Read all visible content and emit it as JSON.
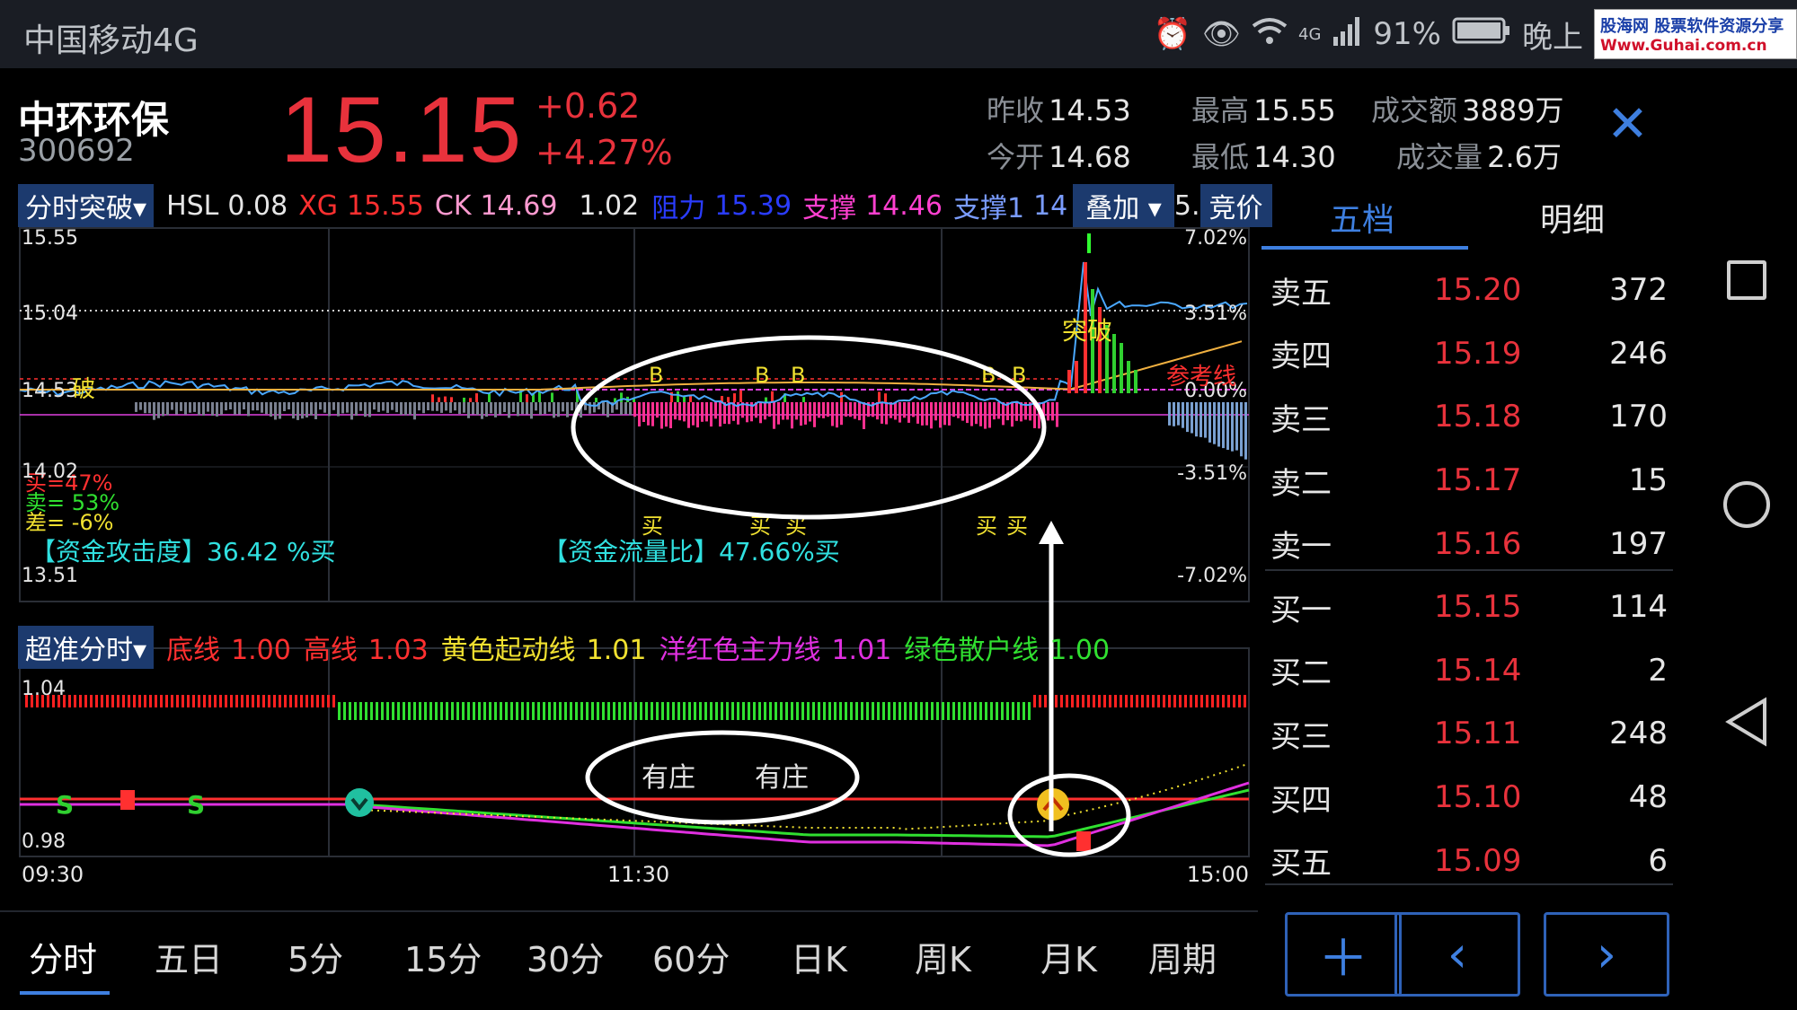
{
  "status_bar": {
    "carrier": "中国移动4G",
    "network": "4G",
    "battery": "91%",
    "time_text": "晚上",
    "watermark_line1": "股海网 股票软件资源分享",
    "watermark_line2": "Www.Guhai.com.cn"
  },
  "stock": {
    "name": "中环环保",
    "code": "300692",
    "price": "15.15",
    "change": "+0.62",
    "change_pct": "+4.27%",
    "quote": {
      "prev_close_label": "昨收",
      "prev_close": "14.53",
      "open_label": "今开",
      "open": "14.68",
      "high_label": "最高",
      "high": "15.55",
      "low_label": "最低",
      "low": "14.30",
      "amount_label": "成交额",
      "amount": "3889万",
      "volume_label": "成交量",
      "volume": "2.6万"
    }
  },
  "indicator_bar": {
    "dropdown": "分时突破",
    "hsl_label": "HSL",
    "hsl": "0.08",
    "xg_label": "XG",
    "xg": "15.55",
    "ck_label": "CK",
    "ck": "14.69",
    "v1": "1.02",
    "zuli_label": "阻力",
    "zuli": "15.39",
    "zhicheng_label": "支撑",
    "zhicheng": "14.46",
    "zhicheng1_label": "支撑1",
    "zhicheng1": "14",
    "overlay": "叠加",
    "trail": "5.",
    "jingjia": "竞价"
  },
  "top_chart": {
    "y_labels_left": [
      "15.55",
      "15.04",
      "14.53",
      "14.02",
      "13.51"
    ],
    "y_labels_right": [
      "7.02%",
      "3.51%",
      "0.00%",
      "-3.51%",
      "-7.02%"
    ],
    "breakout_text": "突破",
    "left_break_text": "破",
    "reference_line_text": "参考线",
    "b_marks": [
      "B",
      "B",
      "B",
      "B",
      "B"
    ],
    "sell_marks": [
      "买",
      "买",
      "买",
      "买",
      "买"
    ],
    "buy_ratio": "买=47%",
    "sell_ratio": "卖= 53%",
    "diff_ratio": "差= -6%",
    "attack": "【资金攻击度】36.42 %买",
    "flow": "【资金流量比】47.66%买"
  },
  "bottom_chart": {
    "dropdown": "超准分时",
    "legend": [
      {
        "label": "底线",
        "value": "1.00",
        "color": "#ff3030"
      },
      {
        "label": "高线",
        "value": "1.03",
        "color": "#ff3030"
      },
      {
        "label": "黄色起动线",
        "value": "1.01",
        "color": "#f0e030"
      },
      {
        "label": "洋红色主力线",
        "value": "1.01",
        "color": "#e030e0"
      },
      {
        "label": "绿色散户线",
        "value": "1.00",
        "color": "#30e030"
      }
    ],
    "y_top": "1.04",
    "y_bottom": "0.98",
    "you_zhuang": [
      "有庄",
      "有庄"
    ],
    "s_marks": [
      "S",
      "S"
    ],
    "time_labels": [
      "09:30",
      "11:30",
      "15:00"
    ]
  },
  "panel_tabs": [
    "五档",
    "明细"
  ],
  "order_book": [
    {
      "label": "卖五",
      "price": "15.20",
      "vol": "372"
    },
    {
      "label": "卖四",
      "price": "15.19",
      "vol": "246"
    },
    {
      "label": "卖三",
      "price": "15.18",
      "vol": "170"
    },
    {
      "label": "卖二",
      "price": "15.17",
      "vol": "15"
    },
    {
      "label": "卖一",
      "price": "15.16",
      "vol": "197"
    },
    {
      "label": "买一",
      "price": "15.15",
      "vol": "114"
    },
    {
      "label": "买二",
      "price": "15.14",
      "vol": "2"
    },
    {
      "label": "买三",
      "price": "15.11",
      "vol": "248"
    },
    {
      "label": "买四",
      "price": "15.10",
      "vol": "48"
    },
    {
      "label": "买五",
      "price": "15.09",
      "vol": "6"
    }
  ],
  "period_tabs": [
    "分时",
    "五日",
    "5分",
    "15分",
    "30分",
    "60分",
    "日K",
    "周K",
    "月K",
    "周期"
  ],
  "colors": {
    "up": "#e8323c",
    "accent": "#3e7fe0",
    "bg": "#000000"
  }
}
